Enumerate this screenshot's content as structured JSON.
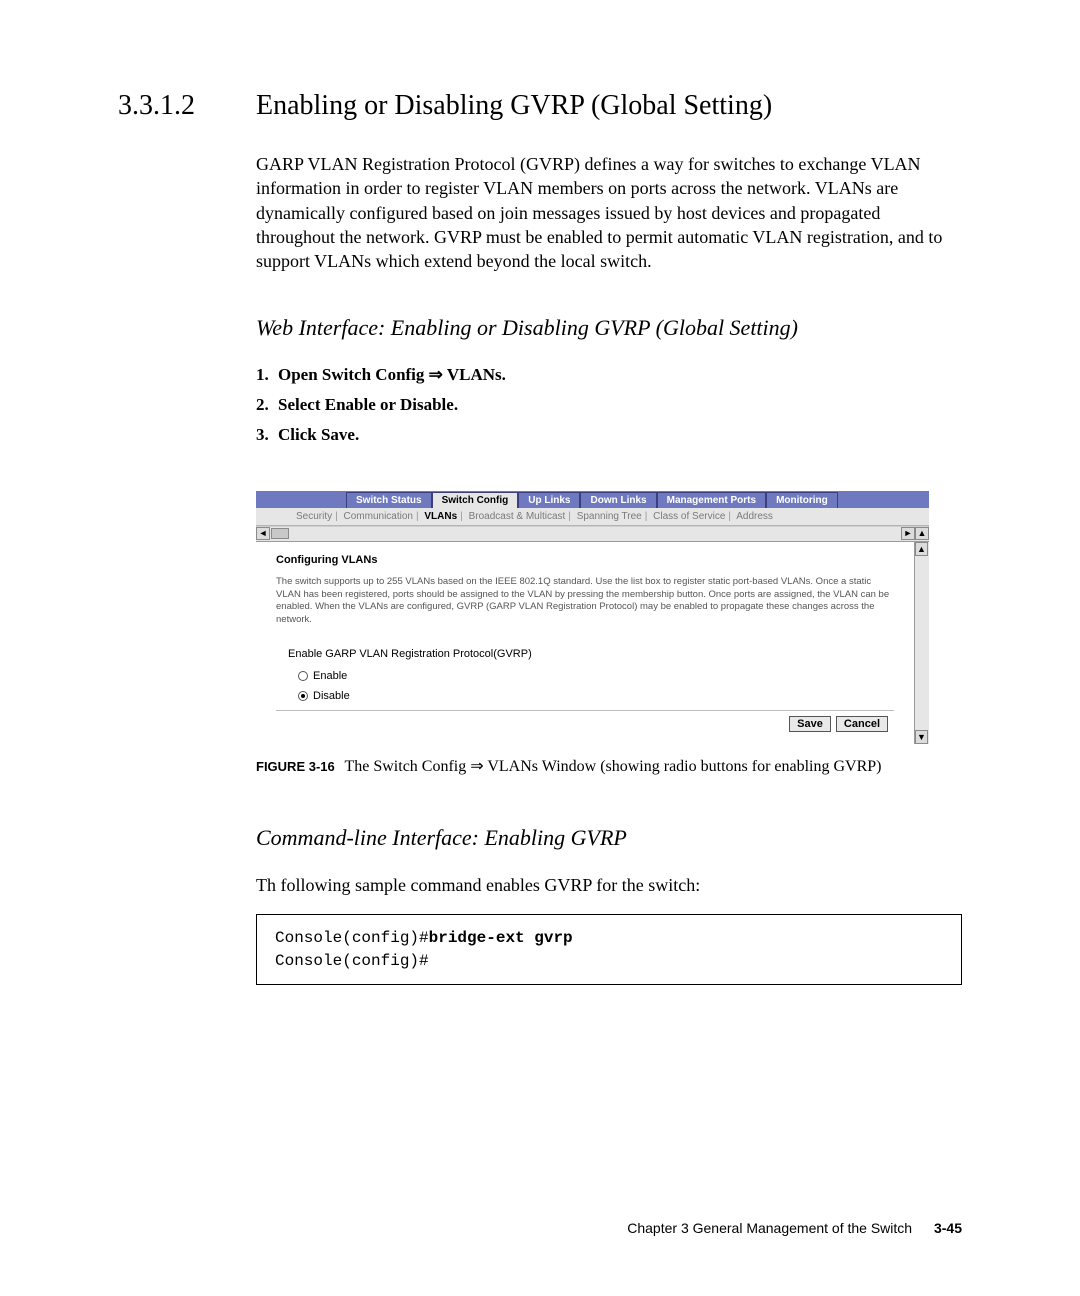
{
  "section": {
    "number": "3.3.1.2",
    "title": "Enabling or Disabling GVRP (Global Setting)",
    "paragraph": "GARP VLAN Registration Protocol (GVRP) defines a way for switches to exchange VLAN information in order to register VLAN members on ports across the network. VLANs are dynamically configured based on join messages issued by host devices and propagated throughout the network. GVRP must be enabled to permit automatic VLAN registration, and to support VLANs which extend beyond the local switch."
  },
  "web_if": {
    "heading": "Web Interface: Enabling or Disabling GVRP (Global Setting)",
    "steps": [
      "Open Switch Config ⇒ VLANs.",
      "Select Enable or Disable.",
      "Click Save."
    ]
  },
  "screenshot": {
    "tabs": [
      "Switch Status",
      "Switch Config",
      "Up Links",
      "Down Links",
      "Management Ports",
      "Monitoring"
    ],
    "active_tab_index": 1,
    "subnav": [
      "Security",
      "Communication",
      "VLANs",
      "Broadcast & Multicast",
      "Spanning Tree",
      "Class of Service",
      "Address"
    ],
    "subnav_selected_index": 2,
    "panel_title": "Configuring VLANs",
    "panel_desc": "The switch supports up to 255 VLANs based on the IEEE 802.1Q standard. Use the list box to register static port-based VLANs. Once a static VLAN has been registered, ports should be assigned to the VLAN by pressing the membership button. Once ports are assigned, the VLAN can be enabled. When the VLANs are configured, GVRP (GARP VLAN Registration Protocol) may be enabled to propagate these changes across the network.",
    "field_label": "Enable GARP VLAN Registration Protocol(GVRP)",
    "radios": {
      "enable": "Enable",
      "disable": "Disable",
      "selected": "disable"
    },
    "buttons": {
      "save": "Save",
      "cancel": "Cancel"
    }
  },
  "figure": {
    "label": "FIGURE 3-16",
    "caption": "The Switch Config ⇒ VLANs Window (showing radio buttons for enabling GVRP)"
  },
  "cli": {
    "heading": "Command-line Interface: Enabling GVRP",
    "intro": "Th following sample command enables GVRP for the switch:",
    "line1_prefix": "Console(config)#",
    "line1_cmd": "bridge-ext gvrp",
    "line2": "Console(config)#"
  },
  "footer": {
    "chapter": "Chapter 3   General Management of the Switch",
    "page": "3-45"
  }
}
